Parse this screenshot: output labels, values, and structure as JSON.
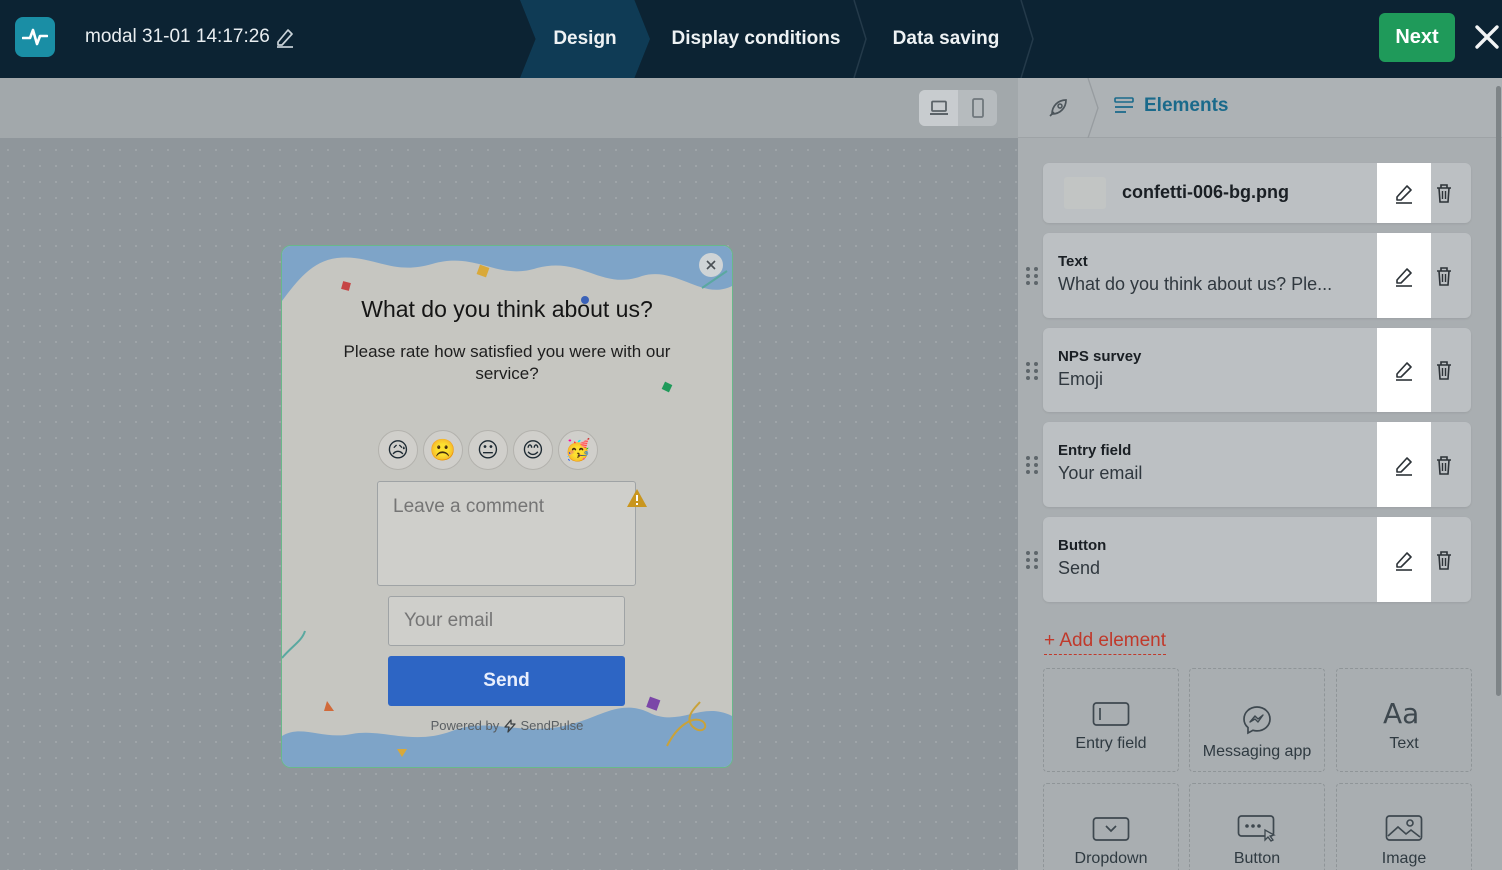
{
  "header": {
    "doc_title": "modal 31-01 14:17:26",
    "steps": [
      {
        "label": "Design",
        "active": true
      },
      {
        "label": "Display conditions",
        "active": false
      },
      {
        "label": "Data saving",
        "active": false
      }
    ],
    "next_label": "Next",
    "icons": {
      "logo": "pulse-logo-icon",
      "edit": "pencil-icon",
      "close": "close-icon"
    },
    "colors": {
      "bar": "#0c2333",
      "active_step": "#0f3b55",
      "next": "#1f9a5a"
    }
  },
  "canvas": {
    "device_toggle": {
      "options": [
        "desktop-icon",
        "mobile-icon"
      ],
      "selected": "desktop"
    }
  },
  "modal": {
    "title": "What do you think about us?",
    "subtitle": "Please rate how satisfied you were with our service?",
    "emojis": [
      "😥",
      "☹️",
      "😐",
      "😊",
      "🥳"
    ],
    "comment_placeholder": "Leave a comment",
    "email_placeholder": "Your email",
    "send_label": "Send",
    "powered_by": "Powered by",
    "brand": "SendPulse",
    "colors": {
      "button": "#2d65c4",
      "border": "#69b88a",
      "wave": "#7ea4c8"
    }
  },
  "panel": {
    "tab_label": "Elements",
    "elements": [
      {
        "type": "",
        "value": "confetti-006-bg.png"
      },
      {
        "type": "Text",
        "value": "What do you think about us? Ple..."
      },
      {
        "type": "NPS survey",
        "value": "Emoji"
      },
      {
        "type": "Entry field",
        "value": "Your email"
      },
      {
        "type": "Button",
        "value": "Send"
      }
    ],
    "add_element_label": "+ Add element",
    "tiles": [
      {
        "label": "Entry field",
        "icon": "entry-field-icon"
      },
      {
        "label": "Messaging app",
        "icon": "messenger-icon"
      },
      {
        "label": "Text",
        "icon": "text-aa-icon"
      },
      {
        "label": "Dropdown",
        "icon": "dropdown-icon"
      },
      {
        "label": "Button",
        "icon": "button-click-icon"
      },
      {
        "label": "Image",
        "icon": "image-icon"
      }
    ],
    "colors": {
      "accent": "#1a6a8b",
      "add": "#c0392b"
    }
  }
}
